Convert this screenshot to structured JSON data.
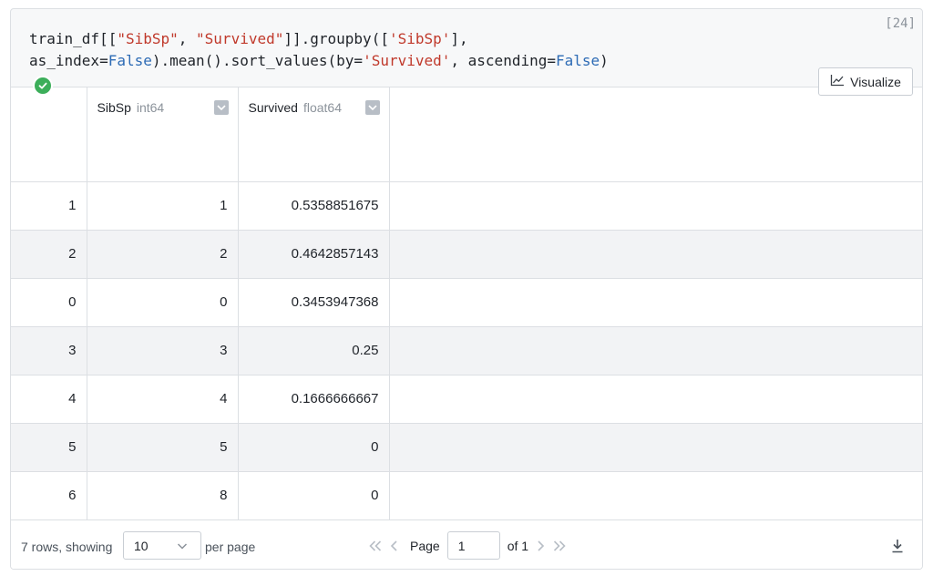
{
  "cell": {
    "exec_count": "[24]",
    "code_line1": [
      {
        "t": "train_df[[",
        "c": ""
      },
      {
        "t": "\"SibSp\"",
        "c": "str"
      },
      {
        "t": ", ",
        "c": ""
      },
      {
        "t": "\"Survived\"",
        "c": "str"
      },
      {
        "t": "]].groupby([",
        "c": ""
      },
      {
        "t": "'SibSp'",
        "c": "str"
      },
      {
        "t": "],",
        "c": ""
      }
    ],
    "code_line2": [
      {
        "t": "as_index=",
        "c": ""
      },
      {
        "t": "False",
        "c": "kw"
      },
      {
        "t": ").mean().sort_values(by=",
        "c": ""
      },
      {
        "t": "'Survived'",
        "c": "str"
      },
      {
        "t": ", ascending=",
        "c": ""
      },
      {
        "t": "False",
        "c": "kw"
      },
      {
        "t": ")",
        "c": ""
      }
    ],
    "visualize_label": "Visualize"
  },
  "table": {
    "columns": [
      {
        "name": "SibSp",
        "type": "int64"
      },
      {
        "name": "Survived",
        "type": "float64"
      }
    ],
    "rows": [
      {
        "index": "1",
        "sibsp": "1",
        "survived": "0.5358851675"
      },
      {
        "index": "2",
        "sibsp": "2",
        "survived": "0.4642857143"
      },
      {
        "index": "0",
        "sibsp": "0",
        "survived": "0.3453947368"
      },
      {
        "index": "3",
        "sibsp": "3",
        "survived": "0.25"
      },
      {
        "index": "4",
        "sibsp": "4",
        "survived": "0.1666666667"
      },
      {
        "index": "5",
        "sibsp": "5",
        "survived": "0"
      },
      {
        "index": "6",
        "sibsp": "8",
        "survived": "0"
      }
    ]
  },
  "footer": {
    "rows_info": "7 rows, showing",
    "per_page_value": "10",
    "per_page_label": "per page",
    "page_label": "Page",
    "page_value": "1",
    "of_label": "of 1"
  },
  "colors": {
    "success": "#3cae5a",
    "string": "#c0392b",
    "keyword": "#2d6bb5"
  }
}
